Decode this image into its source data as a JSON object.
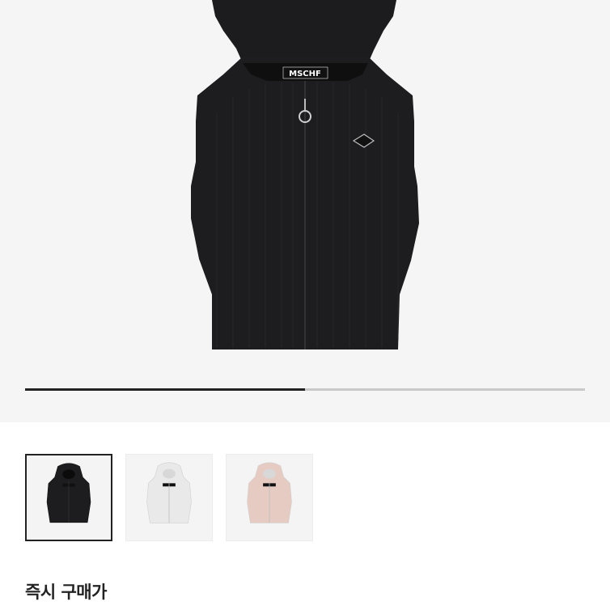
{
  "product": {
    "brand_label": "MSCHF",
    "images": [
      {
        "color": "black",
        "fill": "#1d1d1f",
        "selected": true
      },
      {
        "color": "white",
        "fill": "#e9e9ea",
        "selected": false
      },
      {
        "color": "pink",
        "fill": "#e6cbc2",
        "selected": false
      }
    ]
  },
  "gallery": {
    "progress": 0.5
  },
  "purchase": {
    "instant_buy_label": "즉시 구매가"
  },
  "colors": {
    "hero_background": "#f5f5f5",
    "progress_track": "#c9c9c9",
    "progress_fill": "#222222"
  }
}
